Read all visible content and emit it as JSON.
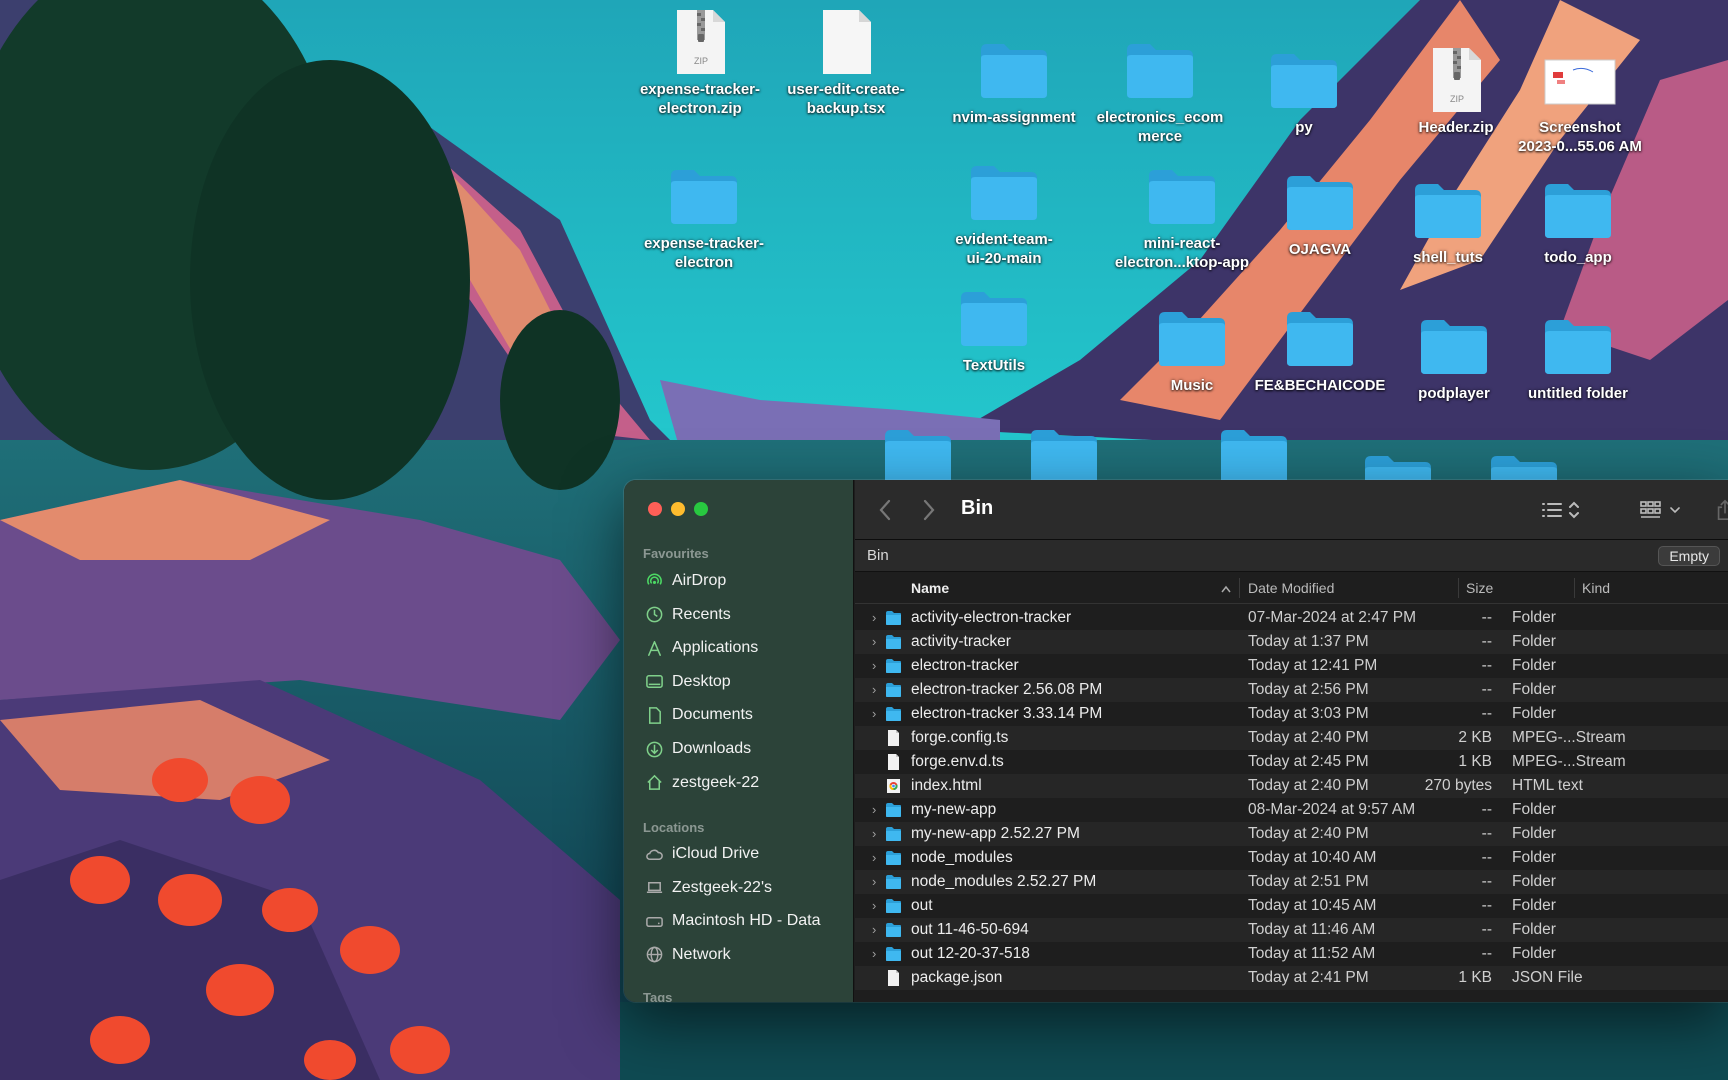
{
  "desktop_icons": [
    {
      "label": "expense-tracker-\nelectron.zip",
      "icon": "zip-file-icon",
      "type": "zip"
    },
    {
      "label": "user-edit-create-\nbackup.tsx",
      "icon": "document-file-icon",
      "type": "file"
    },
    {
      "label": "nvim-assignment",
      "icon": "folder-icon",
      "type": "folder"
    },
    {
      "label": "electronics_ecom\nmerce",
      "icon": "folder-icon",
      "type": "folder"
    },
    {
      "label": "py",
      "icon": "folder-icon",
      "type": "folder"
    },
    {
      "label": "Header.zip",
      "icon": "zip-file-icon",
      "type": "zip"
    },
    {
      "label": "Screenshot\n2023-0...55.06 AM",
      "icon": "screenshot-thumbnail-icon",
      "type": "image"
    },
    {
      "label": "expense-tracker-\nelectron",
      "icon": "folder-icon",
      "type": "folder"
    },
    {
      "label": "evident-team-\nui-20-main",
      "icon": "folder-icon",
      "type": "folder"
    },
    {
      "label": "mini-react-\nelectron...ktop-app",
      "icon": "folder-icon",
      "type": "folder"
    },
    {
      "label": "OJAGVA",
      "icon": "folder-icon",
      "type": "folder"
    },
    {
      "label": "shell_tuts",
      "icon": "folder-icon",
      "type": "folder"
    },
    {
      "label": "todo_app",
      "icon": "folder-icon",
      "type": "folder"
    },
    {
      "label": "TextUtils",
      "icon": "folder-icon",
      "type": "folder"
    },
    {
      "label": "Music",
      "icon": "folder-icon",
      "type": "folder"
    },
    {
      "label": "FE&BECHAICODE",
      "icon": "folder-icon",
      "type": "folder"
    },
    {
      "label": "podplayer",
      "icon": "folder-icon",
      "type": "folder"
    },
    {
      "label": "untitled folder",
      "icon": "folder-icon",
      "type": "folder"
    }
  ],
  "finder": {
    "title": "Bin",
    "path": "Bin",
    "empty_label": "Empty",
    "sidebar": {
      "favourites_label": "Favourites",
      "favourites": [
        {
          "label": "AirDrop",
          "icon": "airdrop-icon"
        },
        {
          "label": "Recents",
          "icon": "clock-icon"
        },
        {
          "label": "Applications",
          "icon": "applications-icon"
        },
        {
          "label": "Desktop",
          "icon": "desktop-icon"
        },
        {
          "label": "Documents",
          "icon": "document-icon"
        },
        {
          "label": "Downloads",
          "icon": "download-icon"
        },
        {
          "label": "zestgeek-22",
          "icon": "home-icon"
        }
      ],
      "locations_label": "Locations",
      "locations": [
        {
          "label": "iCloud Drive",
          "icon": "cloud-icon"
        },
        {
          "label": "Zestgeek-22's",
          "icon": "laptop-icon"
        },
        {
          "label": "Macintosh HD - Data",
          "icon": "hard-drive-icon"
        },
        {
          "label": "Network",
          "icon": "globe-icon"
        }
      ],
      "tags_label": "Tags"
    },
    "columns": {
      "name": "Name",
      "date": "Date Modified",
      "size": "Size",
      "kind": "Kind"
    },
    "files": [
      {
        "name": "activity-electron-tracker",
        "date": "07-Mar-2024 at 2:47 PM",
        "size": "--",
        "kind": "Folder",
        "type": "folder"
      },
      {
        "name": "activity-tracker",
        "date": "Today at 1:37 PM",
        "size": "--",
        "kind": "Folder",
        "type": "folder"
      },
      {
        "name": "electron-tracker",
        "date": "Today at 12:41 PM",
        "size": "--",
        "kind": "Folder",
        "type": "folder"
      },
      {
        "name": "electron-tracker 2.56.08 PM",
        "date": "Today at 2:56 PM",
        "size": "--",
        "kind": "Folder",
        "type": "folder"
      },
      {
        "name": "electron-tracker 3.33.14 PM",
        "date": "Today at 3:03 PM",
        "size": "--",
        "kind": "Folder",
        "type": "folder"
      },
      {
        "name": "forge.config.ts",
        "date": "Today at 2:40 PM",
        "size": "2 KB",
        "kind": "MPEG-...Stream",
        "type": "file"
      },
      {
        "name": "forge.env.d.ts",
        "date": "Today at 2:45 PM",
        "size": "1 KB",
        "kind": "MPEG-...Stream",
        "type": "file"
      },
      {
        "name": "index.html",
        "date": "Today at 2:40 PM",
        "size": "270 bytes",
        "kind": "HTML text",
        "type": "html"
      },
      {
        "name": "my-new-app",
        "date": "08-Mar-2024 at 9:57 AM",
        "size": "--",
        "kind": "Folder",
        "type": "folder"
      },
      {
        "name": "my-new-app 2.52.27 PM",
        "date": "Today at 2:40 PM",
        "size": "--",
        "kind": "Folder",
        "type": "folder"
      },
      {
        "name": "node_modules",
        "date": "Today at 10:40 AM",
        "size": "--",
        "kind": "Folder",
        "type": "folder"
      },
      {
        "name": "node_modules 2.52.27 PM",
        "date": "Today at 2:51 PM",
        "size": "--",
        "kind": "Folder",
        "type": "folder"
      },
      {
        "name": "out",
        "date": "Today at 10:45 AM",
        "size": "--",
        "kind": "Folder",
        "type": "folder"
      },
      {
        "name": "out 11-46-50-694",
        "date": "Today at 11:46 AM",
        "size": "--",
        "kind": "Folder",
        "type": "folder"
      },
      {
        "name": "out 12-20-37-518",
        "date": "Today at 11:52 AM",
        "size": "--",
        "kind": "Folder",
        "type": "folder"
      },
      {
        "name": "package.json",
        "date": "Today at 2:41 PM",
        "size": "1 KB",
        "kind": "JSON File",
        "type": "file"
      }
    ]
  },
  "colors": {
    "folder": "#3fb8f0",
    "accent": "#0a84ff",
    "close": "#ff5f57",
    "minimize": "#febc2e",
    "zoom": "#28c840"
  }
}
